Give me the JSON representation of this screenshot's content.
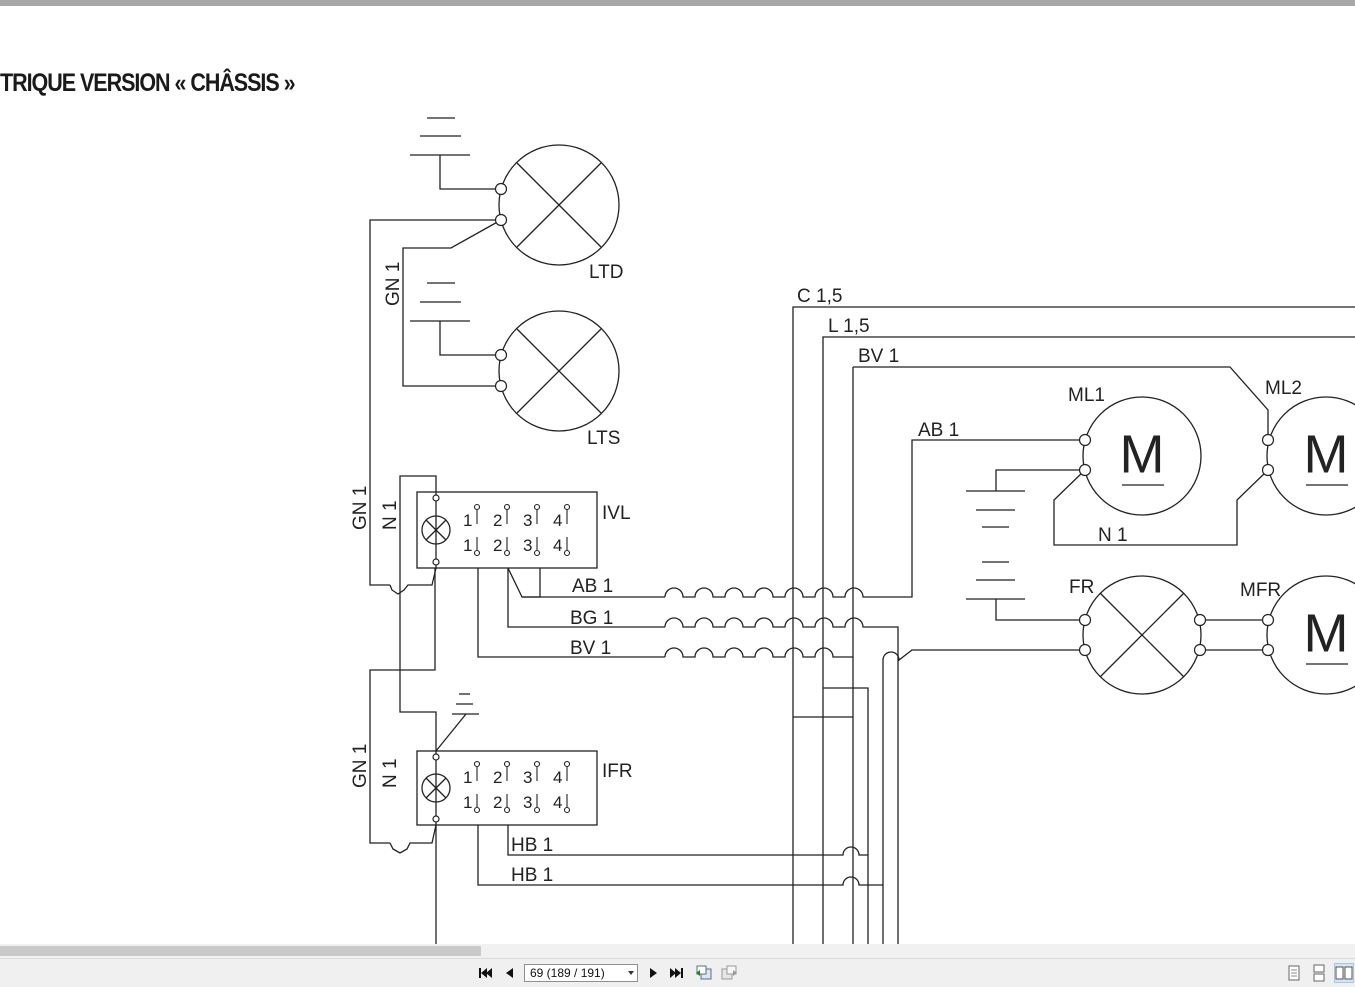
{
  "document": {
    "heading": "TRIQUE VERSION « CHÂSSIS »"
  },
  "diagram": {
    "lamps": {
      "ltd": "LTD",
      "lts": "LTS",
      "fr": "FR"
    },
    "motors": {
      "ml1": "ML1",
      "ml2": "ML2",
      "mfr": "MFR",
      "symbol": "M"
    },
    "switches": {
      "ivl": {
        "label": "IVL",
        "contacts_top": [
          "1",
          "2",
          "3",
          "4"
        ],
        "contacts_bottom": [
          "1",
          "2",
          "3",
          "4"
        ]
      },
      "ifr": {
        "label": "IFR",
        "contacts_top": [
          "1",
          "2",
          "3",
          "4"
        ],
        "contacts_bottom": [
          "1",
          "2",
          "3",
          "4"
        ]
      }
    },
    "wires": {
      "c15": "C 1,5",
      "l15": "L 1,5",
      "bv1_top": "BV 1",
      "ab1_motor": "AB 1",
      "n1_motor": "N 1",
      "gn1_top": "GN 1",
      "gn1_ivl": "GN 1",
      "n1_ivl": "N 1",
      "ab1_ivl": "AB 1",
      "bg1": "BG 1",
      "bv1_ivl": "BV 1",
      "gn1_ifr": "GN 1",
      "n1_ifr": "N 1",
      "hb1_a": "HB 1",
      "hb1_b": "HB 1"
    }
  },
  "viewer": {
    "page_indicator": "69 (189 / 191)",
    "icons": {
      "first": "first-page-icon",
      "prev": "previous-page-icon",
      "next": "next-page-icon",
      "last": "last-page-icon",
      "back": "previous-view-icon",
      "forward": "next-view-icon",
      "single": "single-page-view-icon",
      "continuous": "continuous-view-icon",
      "facing": "facing-pages-view-icon"
    },
    "scroll": {
      "horizontal_fraction": 0.355
    }
  }
}
